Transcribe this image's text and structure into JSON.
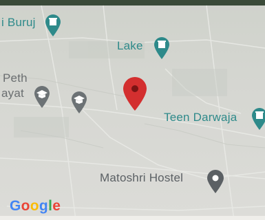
{
  "map": {
    "places": [
      {
        "name": "i Buruj",
        "kind": "landmark",
        "color": "#2e8a8a"
      },
      {
        "name": "Lake",
        "kind": "landmark",
        "color": "#2e8a8a"
      },
      {
        "name": "Peth",
        "kind": "area",
        "color": "#6a6e70"
      },
      {
        "name": "ayat",
        "kind": "area",
        "color": "#6a6e70"
      },
      {
        "name": "Teen Darwaja",
        "kind": "landmark",
        "color": "#2e8a8a"
      },
      {
        "name": "Matoshri Hostel",
        "kind": "place",
        "color": "#5b6064"
      }
    ],
    "icons": {
      "landmark": "monument-icon",
      "school": "school-icon",
      "place": "location-pin-icon",
      "selected": "red-location-pin-icon"
    },
    "logo": {
      "letters": [
        "G",
        "o",
        "o",
        "g",
        "l",
        "e"
      ],
      "colors": [
        "#4285f4",
        "#ea4335",
        "#fbbc05",
        "#4285f4",
        "#34a853",
        "#ea4335"
      ]
    },
    "selected_pin_color": "#d32f2f"
  }
}
